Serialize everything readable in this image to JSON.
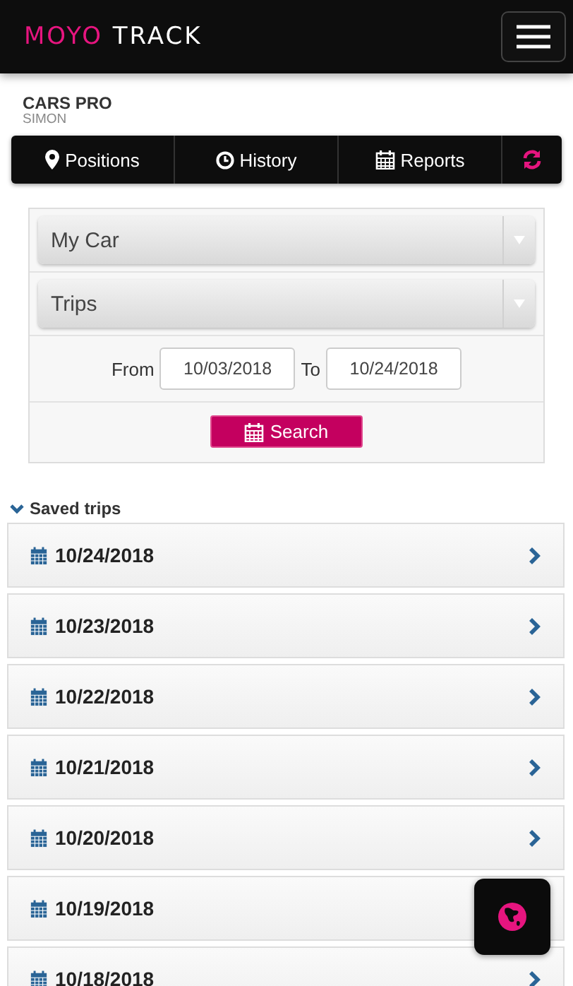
{
  "header": {
    "logo": [
      {
        "text": "MOYO",
        "accent": true
      },
      {
        "text": "TRACK",
        "accent": false
      }
    ]
  },
  "account": {
    "name": "CARS PRO",
    "user": "SIMON"
  },
  "nav": {
    "tabs": [
      {
        "label": "Positions",
        "kind": "pin"
      },
      {
        "label": "History",
        "kind": "clock"
      },
      {
        "label": "Reports",
        "kind": "calendar"
      }
    ]
  },
  "form": {
    "vehicle": {
      "value": "My Car"
    },
    "report_type": {
      "value": "Trips"
    },
    "from_label": "From",
    "from_value": "10/03/2018",
    "to_label": "To",
    "to_value": "10/24/2018",
    "search_button": "Search"
  },
  "saved_trips": {
    "title": "Saved trips",
    "expanded": true,
    "items": [
      {
        "date": "10/24/2018"
      },
      {
        "date": "10/23/2018"
      },
      {
        "date": "10/22/2018"
      },
      {
        "date": "10/21/2018"
      },
      {
        "date": "10/20/2018"
      },
      {
        "date": "10/19/2018"
      },
      {
        "date": "10/18/2018"
      }
    ]
  }
}
